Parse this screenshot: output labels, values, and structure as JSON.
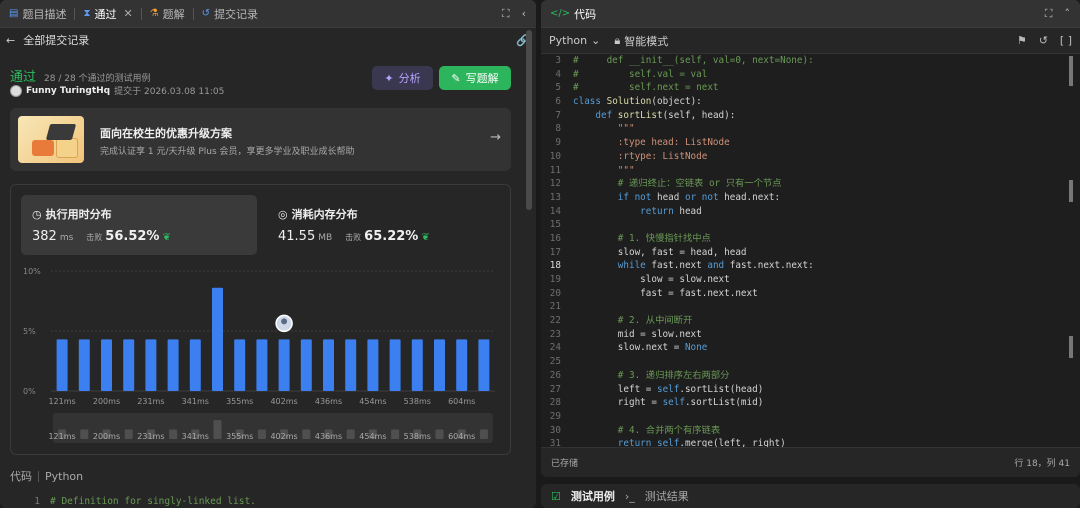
{
  "left_tabs": [
    {
      "label": "题目描述",
      "icon": "document-icon"
    },
    {
      "label": "通过",
      "icon": "hourglass-icon"
    },
    {
      "label": "题解",
      "icon": "flask-icon"
    },
    {
      "label": "提交记录",
      "icon": "history-icon"
    }
  ],
  "subhead": {
    "back_label": "全部提交记录"
  },
  "status": {
    "result": "通过",
    "passed": "28 / 28 个通过的测试用例"
  },
  "submitter": {
    "name": "Funny TuringtHq",
    "submitted_at": "提交于 2026.03.08 11:05"
  },
  "buttons": {
    "analyze": "分析",
    "write_solution": "写题解"
  },
  "promo": {
    "title": "面向在校生的优惠升级方案",
    "subtitle": "完成认证享 1 元/天升级 Plus 会员，享更多学业及职业成长帮助"
  },
  "runtime": {
    "title": "执行用时分布",
    "value": "382",
    "unit": "ms",
    "beat_label": "击败",
    "beat": "56.52%"
  },
  "memory": {
    "title": "消耗内存分布",
    "value": "41.55",
    "unit": "MB",
    "beat_label": "击败",
    "beat": "65.22%"
  },
  "chart_data": {
    "type": "bar",
    "title": "",
    "xlabel": "",
    "ylabel": "",
    "ylim": [
      0,
      10
    ],
    "y_ticks": [
      "0%",
      "5%",
      "10%"
    ],
    "values": [
      4.3,
      4.3,
      4.3,
      4.3,
      4.3,
      4.3,
      4.3,
      8.6,
      4.3,
      4.3,
      4.3,
      4.3,
      4.3,
      4.3,
      4.3,
      4.3,
      4.3,
      4.3,
      4.3,
      4.3
    ],
    "x_tick_labels": [
      "121ms",
      "200ms",
      "231ms",
      "341ms",
      "355ms",
      "402ms",
      "436ms",
      "454ms",
      "538ms",
      "604ms"
    ],
    "highlight_index": 10,
    "bar_color": "#3b7ff0",
    "grid": true
  },
  "left_code": {
    "header_label": "代码",
    "language": "Python",
    "first_line": "# Definition for singly-linked list.",
    "first_line_no": "1"
  },
  "editor": {
    "title": "代码",
    "language": "Python",
    "mode": "智能模式",
    "saved": "已存储",
    "position": "行 18，列 41",
    "lines": [
      {
        "n": "3",
        "html": "<span class='cm'>#     def __init__(self, val=0, next=None):</span>"
      },
      {
        "n": "4",
        "html": "<span class='cm'>#         self.val = val</span>"
      },
      {
        "n": "5",
        "html": "<span class='cm'>#         self.next = next</span>"
      },
      {
        "n": "6",
        "html": "<span class='kw'>class</span> <span class='fn'>Solution</span>(object):"
      },
      {
        "n": "7",
        "html": "    <span class='kw'>def</span> <span class='fn'>sortList</span>(self, head):"
      },
      {
        "n": "8",
        "html": "        <span class='st'>\"\"\"</span>"
      },
      {
        "n": "9",
        "html": "        <span class='st'>:type head: ListNode</span>"
      },
      {
        "n": "10",
        "html": "        <span class='st'>:rtype: ListNode</span>"
      },
      {
        "n": "11",
        "html": "        <span class='st'>\"\"\"</span>"
      },
      {
        "n": "12",
        "html": "        <span class='cm'># 递归终止：空链表 or 只有一个节点</span>"
      },
      {
        "n": "13",
        "html": "        <span class='kw'>if not</span> head <span class='kw'>or not</span> head.next:"
      },
      {
        "n": "14",
        "html": "            <span class='kw'>return</span> head"
      },
      {
        "n": "15",
        "html": ""
      },
      {
        "n": "16",
        "html": "        <span class='cm'># 1. 快慢指针找中点</span>"
      },
      {
        "n": "17",
        "html": "        slow, fast = head, head"
      },
      {
        "n": "18",
        "html": "        <span class='kw'>while</span> fast.next <span class='kw'>and</span> fast.next.next:"
      },
      {
        "n": "19",
        "html": "            slow = slow.next"
      },
      {
        "n": "20",
        "html": "            fast = fast.next.next"
      },
      {
        "n": "21",
        "html": ""
      },
      {
        "n": "22",
        "html": "        <span class='cm'># 2. 从中间断开</span>"
      },
      {
        "n": "23",
        "html": "        mid = slow.next"
      },
      {
        "n": "24",
        "html": "        slow.next = <span class='kw'>None</span>"
      },
      {
        "n": "25",
        "html": ""
      },
      {
        "n": "26",
        "html": "        <span class='cm'># 3. 递归排序左右两部分</span>"
      },
      {
        "n": "27",
        "html": "        left = <span class='self'>self</span>.sortList(head)"
      },
      {
        "n": "28",
        "html": "        right = <span class='self'>self</span>.sortList(mid)"
      },
      {
        "n": "29",
        "html": ""
      },
      {
        "n": "30",
        "html": "        <span class='cm'># 4. 合并两个有序链表</span>"
      },
      {
        "n": "31",
        "html": "        <span class='kw'>return</span> <span class='self'>self</span>.merge(left, right)"
      }
    ],
    "current_line": "18"
  },
  "bottom_tabs": {
    "test_cases": "测试用例",
    "test_results": "测试结果"
  }
}
